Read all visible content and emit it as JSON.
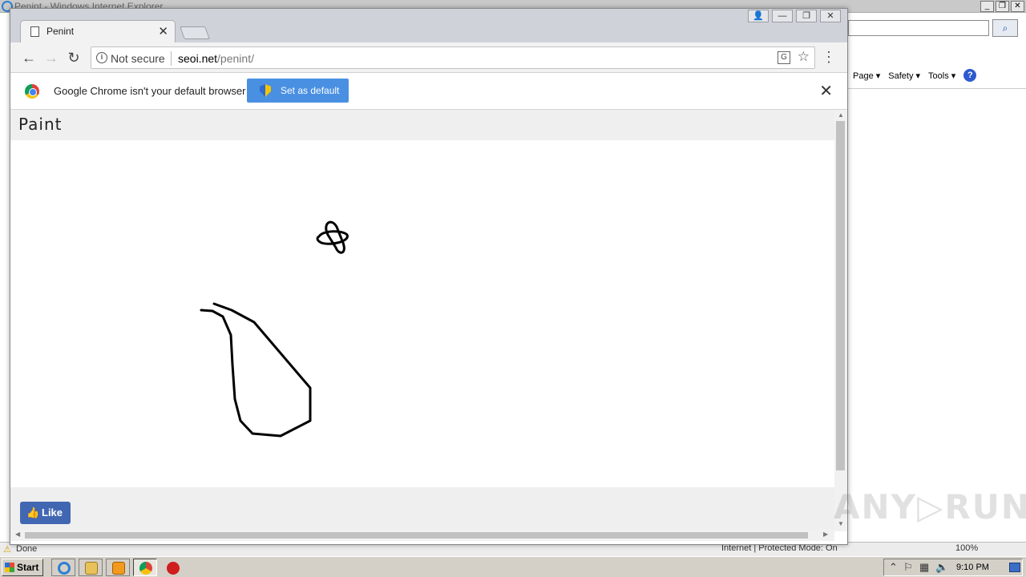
{
  "ie": {
    "window_title": "Penint - Windows Internet Explorer",
    "min_btn": "_",
    "restore_btn": "❐",
    "close_btn": "✕",
    "search_btn": "⌕",
    "commands": [
      "Page ▾",
      "Safety ▾",
      "Tools ▾"
    ],
    "help_btn": "?",
    "status_text": "Done",
    "zone_text": "Internet | Protected Mode: On",
    "zoom_text": "100%"
  },
  "chrome": {
    "tab_title": "Penint",
    "tab_close": "✕",
    "window_buttons": [
      "👤",
      "—",
      "❐",
      "✕"
    ],
    "security_label": "Not secure",
    "url_host": "seoi.net",
    "url_path": "/penint/",
    "infobar_message": "Google Chrome isn't your default browser",
    "infobar_button": "Set as default",
    "infobar_close": "✕"
  },
  "page": {
    "heading": "Paint",
    "like_label": "Like"
  },
  "taskbar": {
    "start_label": "Start",
    "clock": "9:10 PM"
  },
  "colors": {
    "ie_blue": "#2d7fd3",
    "chrome_button_blue": "#4a90e2",
    "facebook_blue": "#4267b2",
    "stroke": "#000000"
  },
  "watermark": "ANY▷RUN"
}
